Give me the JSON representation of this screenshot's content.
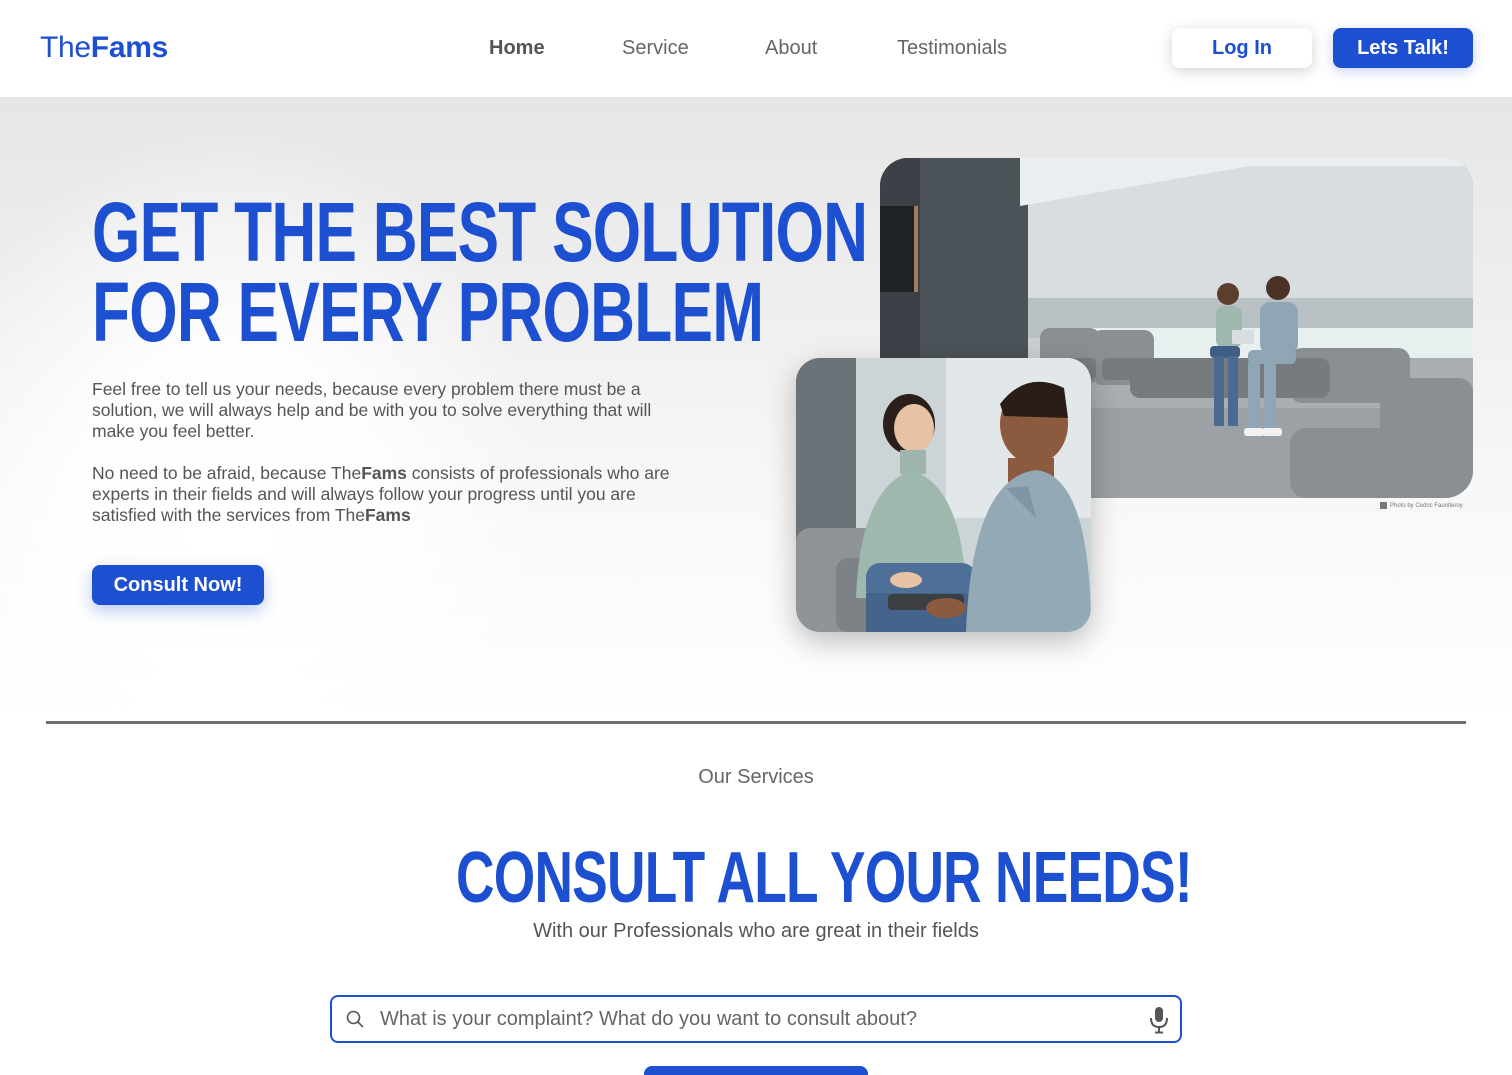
{
  "nav": {
    "logo_prefix": "The",
    "logo_bold": "Fams",
    "links": [
      "Home",
      "Service",
      "About",
      "Testimonials"
    ],
    "active": "Home",
    "login_label": "Log In",
    "talk_label": "Lets Talk!"
  },
  "hero": {
    "title_line1": "Get the best solution",
    "title_line2": "for every problem",
    "p1": "Feel free to tell us your needs, because every problem there must be a solution, we will always help and be with you to solve everything that will make you feel better.",
    "p2_a": "No need to be afraid, because The",
    "p2_b": "Fams",
    "p2_c": " consists of professionals who are experts in their fields and will always follow your progress until you are satisfied with the services from The",
    "p2_d": "Fams",
    "consult_label": "Consult Now!",
    "photo_credit": "Photo by Cedric Fauntleroy"
  },
  "services": {
    "eyebrow": "Our Services",
    "title": "Consult all your needs!",
    "subtitle": "With our Professionals who are great in their fields",
    "search_placeholder": "What is your complaint? What do you want to consult about?"
  },
  "colors": {
    "brand": "#1d4fd1",
    "text": "#555555",
    "divider": "#6e6e6e"
  },
  "icons": {
    "search": "search-icon",
    "mic": "microphone-icon"
  }
}
